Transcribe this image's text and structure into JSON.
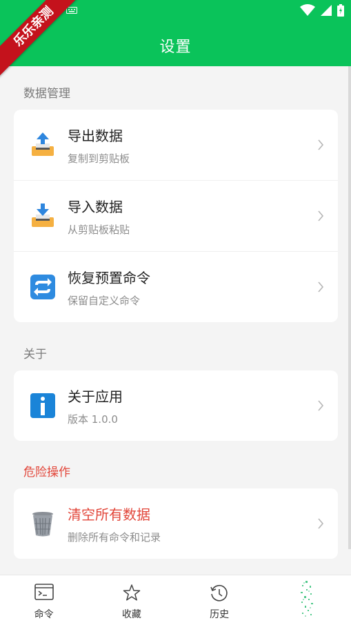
{
  "watermark": "乐乐亲测",
  "appbar": {
    "title": "设置"
  },
  "sections": {
    "data": {
      "title": "数据管理",
      "items": [
        {
          "title": "导出数据",
          "subtitle": "复制到剪贴板",
          "icon": "export-tray-icon"
        },
        {
          "title": "导入数据",
          "subtitle": "从剪贴板粘贴",
          "icon": "import-tray-icon"
        },
        {
          "title": "恢复预置命令",
          "subtitle": "保留自定义命令",
          "icon": "restore-arrows-icon"
        }
      ]
    },
    "about": {
      "title": "关于",
      "items": [
        {
          "title": "关于应用",
          "subtitle": "版本 1.0.0",
          "icon": "info-icon"
        }
      ]
    },
    "danger": {
      "title": "危险操作",
      "items": [
        {
          "title": "清空所有数据",
          "subtitle": "删除所有命令和记录",
          "icon": "trash-can-icon"
        }
      ]
    }
  },
  "bottom_nav": {
    "tabs": [
      {
        "label": "命令",
        "icon": "terminal-icon"
      },
      {
        "label": "收藏",
        "icon": "star-icon"
      },
      {
        "label": "历史",
        "icon": "history-clock-icon"
      },
      {
        "label": "",
        "icon": "sparkle-icon"
      }
    ]
  },
  "colors": {
    "primary": "#0ac35a",
    "danger": "#e2463a",
    "ribbon": "#c4121c"
  }
}
